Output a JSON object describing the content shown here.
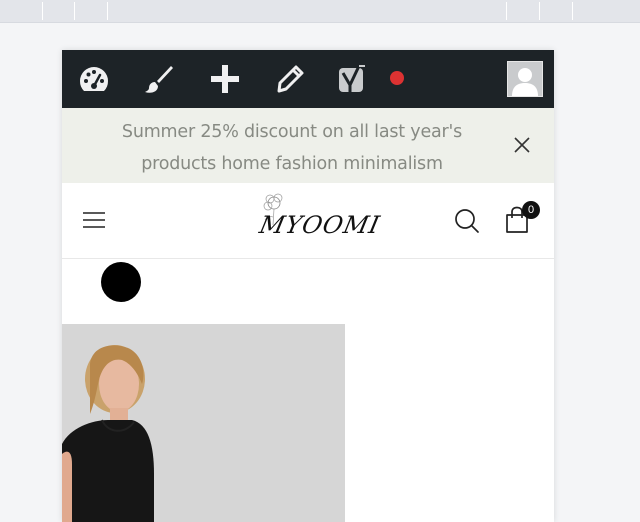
{
  "admin_bar": {
    "items": [
      {
        "icon": "dashboard-icon"
      },
      {
        "icon": "customize-brush-icon"
      },
      {
        "icon": "add-new-icon"
      },
      {
        "icon": "edit-pencil-icon"
      },
      {
        "icon": "yoast-seo-icon"
      }
    ],
    "seo_status_color": "#dc3232",
    "avatar_icon": "user-avatar-icon"
  },
  "announcement": {
    "text": "Summer 25% discount on all last year's products home fashion minimalism"
  },
  "header": {
    "logo_text": "MYOOMI",
    "cart_count": "0"
  },
  "colors": {
    "admin_bar_bg": "#1d2327",
    "announcement_bg": "#eef0ea",
    "announcement_text": "#878a83"
  }
}
